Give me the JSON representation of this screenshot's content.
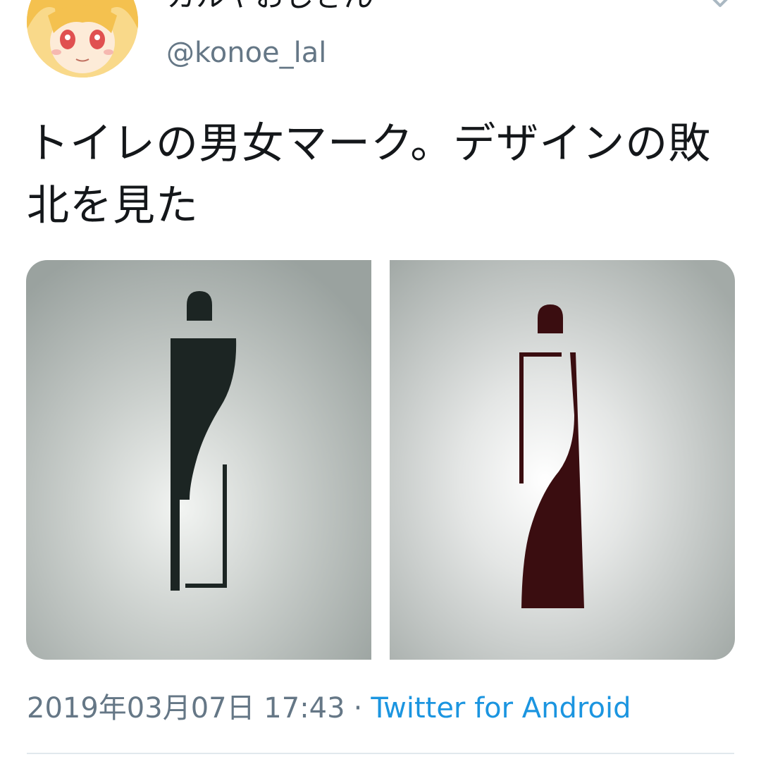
{
  "tweet": {
    "display_name": "カルヤおじさん",
    "handle": "@konoe_lal",
    "text": "トイレの男女マーク。デザインの敗北を見た",
    "timestamp": "2019年03月07日 17:43",
    "separator": "·",
    "client": "Twitter for Android"
  },
  "colors": {
    "text": "#14171a",
    "secondary": "#657786",
    "link": "#1b95e0",
    "divider": "#e1e8ed",
    "men_sign": "#1c2523",
    "women_sign": "#3a0d10"
  },
  "icons": {
    "more": "chevron-down-icon",
    "avatar": "anime-avatar"
  }
}
